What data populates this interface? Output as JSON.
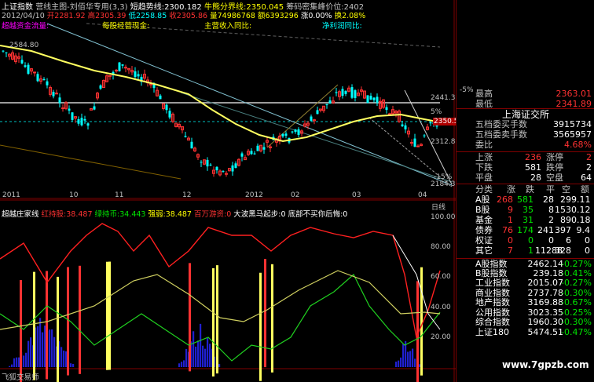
{
  "top_bar": {
    "items": [
      {
        "text": "上证指数",
        "color": "#ffffff"
      },
      {
        "text": "营线主图-刘佰华专用(3,3)",
        "color": "#c0c0c0"
      },
      {
        "text": "短趋势线:2300.182",
        "color": "#ffffff"
      },
      {
        "text": "牛熊分界线:2350.045",
        "color": "#ffff00"
      },
      {
        "text": "筹码密集峰价位:2402",
        "color": "#c0c0c0"
      }
    ],
    "line2": [
      {
        "text": "2012/04/10",
        "color": "#c0c0c0"
      },
      {
        "text": "开2281.92",
        "color": "#ff3232"
      },
      {
        "text": "高2305.39",
        "color": "#ff3232"
      },
      {
        "text": "低2258.85",
        "color": "#00ffff"
      },
      {
        "text": "收2305.86",
        "color": "#ff3232"
      },
      {
        "text": "量74986768",
        "color": "#ffff00"
      },
      {
        "text": "额6393296",
        "color": "#ffff00"
      },
      {
        "text": "涨0.00%",
        "color": "#ffffff"
      },
      {
        "text": "换2.08%",
        "color": "#ffff00"
      }
    ],
    "line3": [
      {
        "text": "超越资金流量:",
        "color": "#ff00ff"
      },
      {
        "text": "每股经营现金:",
        "color": "#ffff00"
      },
      {
        "text": "主营收入同比:",
        "color": "#ffff00"
      },
      {
        "text": "净利润同比:",
        "color": "#00ffff"
      }
    ]
  },
  "price_labels": {
    "p2584": "2584.80",
    "p2441": "2441.3",
    "p2350": "2350.5",
    "p2312": "2312.8",
    "p2184": "2184.3",
    "pct5": "5%",
    "pct_neg15": "-15%"
  },
  "x_axis_labels": [
    "2011",
    "10",
    "11",
    "12",
    "2012",
    "02",
    "03",
    "04"
  ],
  "indicator": {
    "title": "超越庄家线",
    "items": [
      {
        "text": "红持股:38.487",
        "color": "#ff3232"
      },
      {
        "text": "绿持币:34.443",
        "color": "#00e600"
      },
      {
        "text": "强弱:38.487",
        "color": "#ffff00"
      },
      {
        "text": "百万游资:0",
        "color": "#ff3232"
      },
      {
        "text": "大波黑马起步:0",
        "color": "#ffffff"
      },
      {
        "text": "底部不买你后悔:0",
        "color": "#ffffff"
      }
    ],
    "scale": [
      "100.00",
      "80.00",
      "60.00",
      "40.00",
      "20.00"
    ],
    "right_label": "日线",
    "footer": "飞狐交易师"
  },
  "panel": {
    "header_pct": "-5%",
    "highest_label": "最高",
    "highest_value": "2363.01",
    "lowest_label": "最低",
    "lowest_value": "2341.89",
    "exchange": "上海证交所",
    "buy5_label": "五档委买手数",
    "buy5_value": "3915734",
    "sell5_label": "五档委卖手数",
    "sell5_value": "3565957",
    "ratio_label": "委比",
    "ratio_value": "4.68%",
    "stats": [
      {
        "a": "上涨",
        "av": "236",
        "b": "涨停",
        "bv": "2"
      },
      {
        "a": "下跌",
        "av": "581",
        "b": "跌停",
        "bv": "2"
      },
      {
        "a": "平盘",
        "av": "28",
        "b": "空盘",
        "bv": "64"
      }
    ],
    "table_header": [
      "分类",
      "涨",
      "跌",
      "平",
      "空",
      "额"
    ],
    "table": [
      {
        "name": "A股",
        "up": "268",
        "down": "581",
        "flat": "28",
        "empty": "29",
        "amt": "9.11"
      },
      {
        "name": "B股",
        "up": "9",
        "down": "35",
        "flat": "8",
        "empty": "153",
        "amt": "0.12"
      },
      {
        "name": "基金",
        "up": "1",
        "down": "31",
        "flat": "2",
        "empty": "89",
        "amt": "0.18"
      },
      {
        "name": "债券",
        "up": "76",
        "down": "174",
        "flat": "241",
        "empty": "397",
        "amt": "9.4"
      },
      {
        "name": "权证",
        "up": "0",
        "down": "0",
        "flat": "0",
        "empty": "6",
        "amt": "0"
      },
      {
        "name": "其它",
        "up": "7",
        "down": "1",
        "flat": "11288",
        "empty": "328",
        "amt": "0"
      }
    ],
    "indices": [
      {
        "name": "A股指数",
        "value": "2462.14",
        "change": "-0.27%"
      },
      {
        "name": "B股指数",
        "value": "239.18",
        "change": "-0.41%"
      },
      {
        "name": "工业指数",
        "value": "2015.07",
        "change": "-0.27%"
      },
      {
        "name": "商业指数",
        "value": "2737.78",
        "change": "-0.30%"
      },
      {
        "name": "地产指数",
        "value": "3169.88",
        "change": "-0.67%"
      },
      {
        "name": "公用指数",
        "value": "3023.35",
        "change": "-0.25%"
      },
      {
        "name": "综合指数",
        "value": "1960.30",
        "change": "-0.30%"
      },
      {
        "name": "上证180",
        "value": "5474.51",
        "change": "-0.47%"
      }
    ],
    "watermark": "www.7gpzb.com"
  },
  "colors": {
    "up": "#ff3232",
    "down": "#00ffff",
    "ma": "#ffff60",
    "bg": "#000000"
  }
}
